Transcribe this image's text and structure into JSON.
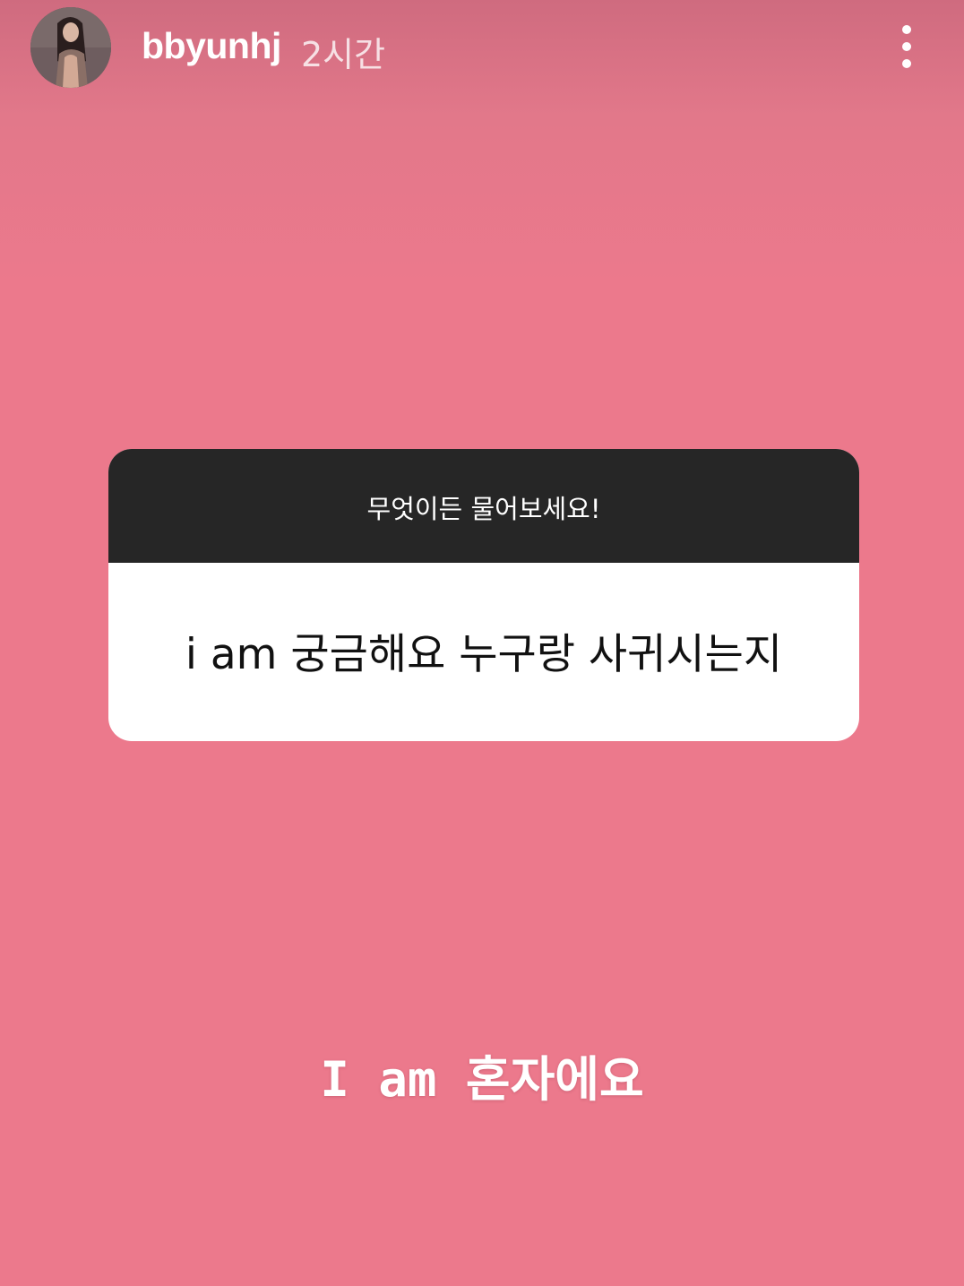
{
  "story": {
    "username": "bbyunhj",
    "time_ago": "2시간",
    "background_color": "#ec798c",
    "more_icon": "more-vertical-icon"
  },
  "question_sticker": {
    "header": "무엇이든 물어보세요!",
    "question": "i am 궁금해요 누구랑 사귀시는지",
    "header_color": "#262626",
    "body_color": "#ffffff"
  },
  "answer": {
    "text": "I am 혼자에요"
  }
}
